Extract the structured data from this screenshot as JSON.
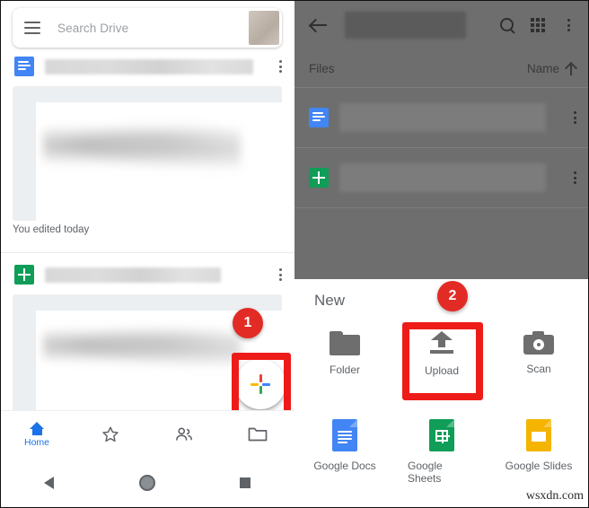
{
  "left_panel": {
    "search": {
      "placeholder": "Search Drive",
      "menu_icon": "hamburger-icon",
      "avatar": "account-avatar"
    },
    "file_rows": [
      {
        "icon": "google-docs-icon",
        "name_redacted": "",
        "overflow": "more-options-icon"
      },
      {
        "icon": "google-sheets-icon",
        "name_redacted": "",
        "overflow": "more-options-icon"
      }
    ],
    "edited_label": "You edited today",
    "fab": {
      "icon": "google-plus-icon",
      "label": ""
    },
    "bottom_nav": [
      {
        "icon": "home-icon",
        "label": "Home",
        "active": true
      },
      {
        "icon": "star-icon",
        "label": "",
        "active": false
      },
      {
        "icon": "shared-people-icon",
        "label": "",
        "active": false
      },
      {
        "icon": "folder-icon",
        "label": "",
        "active": false
      }
    ],
    "system_nav": [
      {
        "icon": "back-triangle-icon"
      },
      {
        "icon": "home-circle-icon"
      },
      {
        "icon": "recents-square-icon"
      }
    ]
  },
  "right_panel": {
    "top_bar": {
      "back_icon": "back-arrow-icon",
      "title_redacted": "",
      "search_icon": "search-icon",
      "grid_icon": "grid-view-icon",
      "overflow_icon": "more-options-icon"
    },
    "list_header": {
      "files_label": "Files",
      "sort_label": "Name",
      "sort_direction_icon": "arrow-up-icon"
    },
    "file_rows": [
      {
        "icon": "google-docs-icon",
        "name_redacted": "",
        "overflow": "more-options-icon"
      },
      {
        "icon": "google-sheets-icon",
        "name_redacted": "",
        "overflow": "more-options-icon"
      }
    ],
    "new_sheet": {
      "title": "New",
      "items": [
        {
          "icon": "folder-icon",
          "label": "Folder"
        },
        {
          "icon": "upload-icon",
          "label": "Upload"
        },
        {
          "icon": "camera-scan-icon",
          "label": "Scan"
        },
        {
          "icon": "google-docs-icon",
          "label": "Google Docs"
        },
        {
          "icon": "google-sheets-icon",
          "label": "Google Sheets"
        },
        {
          "icon": "google-slides-icon",
          "label": "Google Slides"
        }
      ]
    }
  },
  "annotations": {
    "step_one": "1",
    "step_two": "2",
    "highlight_color": "#ee1c19",
    "badge_color": "#e32b26"
  },
  "watermark": "wsxdn.com"
}
